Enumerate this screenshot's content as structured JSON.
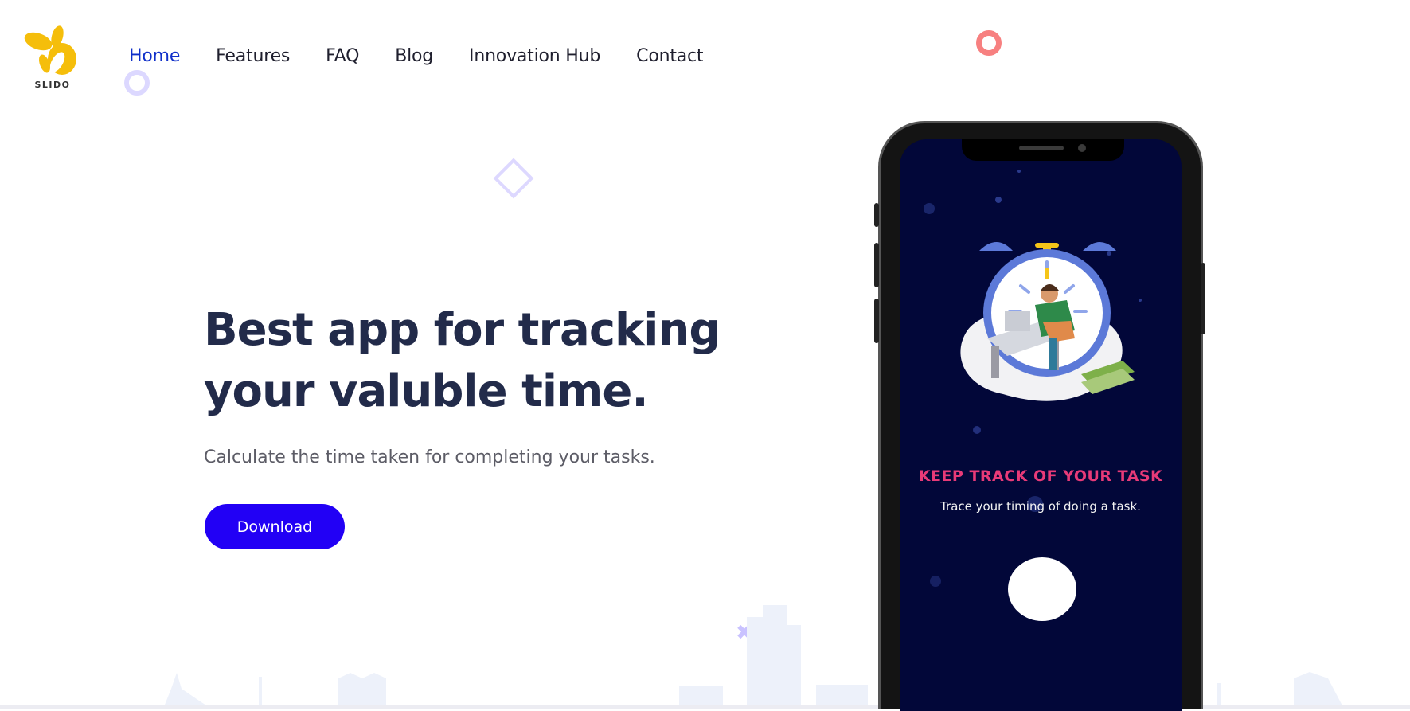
{
  "brand": {
    "name": "SLIDO",
    "logo_color": "#f5be0b"
  },
  "nav": {
    "items": [
      {
        "label": "Home",
        "active": true
      },
      {
        "label": "Features",
        "active": false
      },
      {
        "label": "FAQ",
        "active": false
      },
      {
        "label": "Blog",
        "active": false
      },
      {
        "label": "Innovation Hub",
        "active": false
      },
      {
        "label": "Contact",
        "active": false
      }
    ],
    "active_color": "#0f2fc9"
  },
  "hero": {
    "title": "Best app for tracking your valuble time.",
    "subtitle": "Calculate the time taken for completing your tasks.",
    "download_label": "Download",
    "button_color": "#2200f5"
  },
  "phone_screen": {
    "title": "KEEP TRACK OF YOUR TASK",
    "subtitle": "Trace your timing of doing a task.",
    "background": "#020739",
    "title_color": "#e83a78",
    "illustration": "alarm-clock-workspace-illustration",
    "start_button": "round-white-button"
  }
}
